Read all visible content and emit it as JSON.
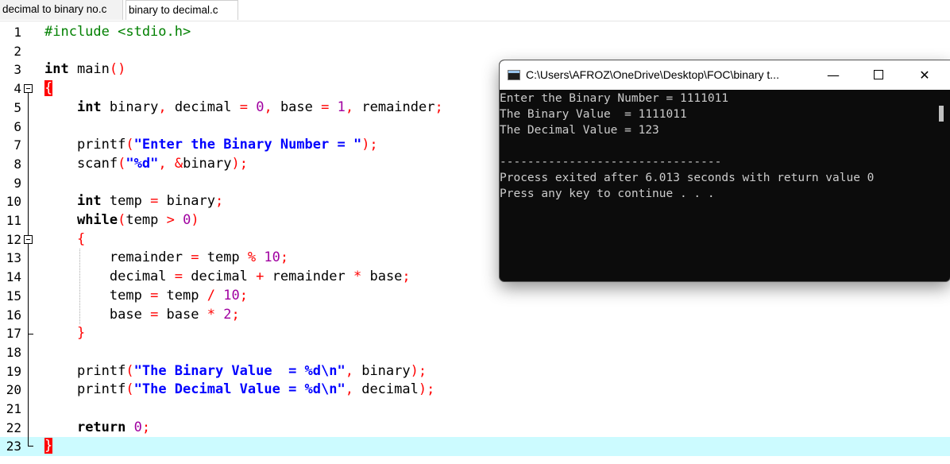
{
  "tabs": [
    {
      "label": "decimal to binary no.c",
      "active": false
    },
    {
      "label": "binary to decimal.c",
      "active": true
    }
  ],
  "editor": {
    "line_numbers": [
      "1",
      "2",
      "3",
      "4",
      "5",
      "6",
      "7",
      "8",
      "9",
      "10",
      "11",
      "12",
      "13",
      "14",
      "15",
      "16",
      "17",
      "18",
      "19",
      "20",
      "21",
      "22",
      "23"
    ],
    "current_line": 23
  },
  "console": {
    "title": "C:\\Users\\AFROZ\\OneDrive\\Desktop\\FOC\\binary t...",
    "buttons": {
      "minimize": "—",
      "close": "✕"
    },
    "lines": [
      "Enter the Binary Number = 1111011",
      "The Binary Value  = 1111011",
      "The Decimal Value = 123",
      "",
      "--------------------------------",
      "Process exited after 6.013 seconds with return value 0",
      "Press any key to continue . . ."
    ]
  },
  "colors": {
    "keyword": "#000000",
    "preprocessor": "#008000",
    "string": "#0000ff",
    "number": "#a000a0",
    "operator": "#ff0000",
    "current_line_bg": "#ccfbff",
    "console_bg": "#0c0c0c",
    "console_text": "#cccccc"
  },
  "icons": [
    "console-window-icon",
    "fold-minus-icon"
  ]
}
